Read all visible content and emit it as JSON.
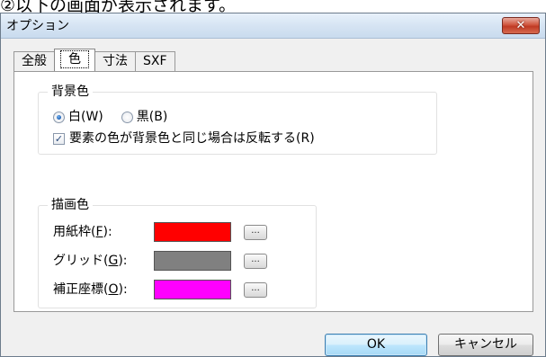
{
  "caption": "②以下の画面が表示されます。",
  "dialog": {
    "title": "オプション",
    "close_label": "✕"
  },
  "tabs": [
    {
      "label": "全般",
      "active": false
    },
    {
      "label": "色",
      "active": true
    },
    {
      "label": "寸法",
      "active": false
    },
    {
      "label": "SXF",
      "active": false
    }
  ],
  "background_group": {
    "label": "背景色",
    "radio_white": "白(W)",
    "radio_black": "黒(B)",
    "selected": "白(W)",
    "invert_checkbox_label": "要素の色が背景色と同じ場合は反転する(R)",
    "invert_checked": true
  },
  "drawing_group": {
    "label": "描画色",
    "rows": [
      {
        "label_prefix": "用紙枠(",
        "label_key": "F",
        "label_suffix": "):",
        "color": "#ff0000"
      },
      {
        "label_prefix": "グリッド(",
        "label_key": "G",
        "label_suffix": "):",
        "color": "#808080"
      },
      {
        "label_prefix": "補正座標(",
        "label_key": "O",
        "label_suffix": "):",
        "color": "#ff00ff"
      }
    ],
    "picker_label": "..."
  },
  "buttons": {
    "ok": "OK",
    "cancel": "キャンセル"
  }
}
